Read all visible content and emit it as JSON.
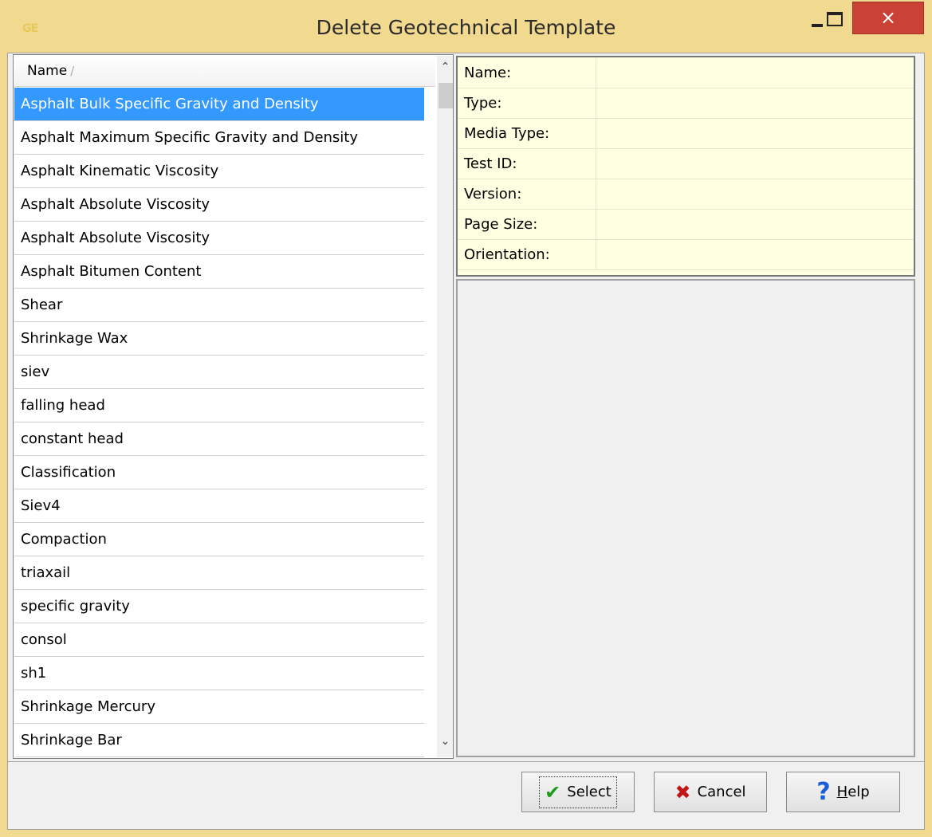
{
  "window": {
    "title": "Delete Geotechnical Template",
    "app_icon_text": "GE",
    "close_glyph": "×"
  },
  "list": {
    "column_header": "Name",
    "sort_glyph": "/",
    "selected_index": 0,
    "items": [
      "Asphalt Bulk Specific Gravity and Density",
      "Asphalt Maximum Specific Gravity and Density",
      "Asphalt Kinematic Viscosity",
      "Asphalt Absolute Viscosity",
      "Asphalt Absolute Viscosity",
      "Asphalt Bitumen Content",
      "Shear",
      "Shrinkage Wax",
      "siev",
      "falling head",
      "constant head",
      "Classification",
      "Siev4",
      "Compaction",
      "triaxail",
      "specific gravity",
      "consol",
      "sh1",
      "Shrinkage Mercury",
      "Shrinkage Bar"
    ]
  },
  "properties": [
    {
      "label": "Name:",
      "value": ""
    },
    {
      "label": "Type:",
      "value": ""
    },
    {
      "label": "Media Type:",
      "value": ""
    },
    {
      "label": "Test ID:",
      "value": ""
    },
    {
      "label": "Version:",
      "value": ""
    },
    {
      "label": "Page Size:",
      "value": ""
    },
    {
      "label": "Orientation:",
      "value": ""
    }
  ],
  "buttons": {
    "select_label": "Select",
    "cancel_label": "Cancel",
    "help_label_prefix": "",
    "help_mnemonic": "H",
    "help_label_rest": "elp"
  },
  "icons": {
    "select": "check-icon",
    "cancel": "x-icon",
    "help": "question-icon",
    "scroll_up": "chevron-up-icon",
    "scroll_down": "chevron-down-icon"
  },
  "colors": {
    "frame": "#f1d98f",
    "selection": "#3399ff",
    "close_button": "#c94235",
    "properties_bg": "#ffffe1"
  }
}
